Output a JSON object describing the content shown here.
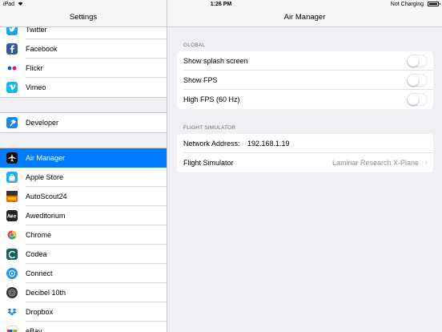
{
  "status": {
    "device": "iPad",
    "time": "1:26 PM",
    "charging": "Not Charging"
  },
  "sidebar": {
    "title": "Settings",
    "group1": [
      {
        "label": "Twitter",
        "icon": "twitter-icon",
        "color": "#1da1f2"
      },
      {
        "label": "Facebook",
        "icon": "facebook-icon",
        "color": "#3b5998"
      },
      {
        "label": "Flickr",
        "icon": "flickr-icon",
        "color": "#ffffff"
      },
      {
        "label": "Vimeo",
        "icon": "vimeo-icon",
        "color": "#1ab7ea"
      }
    ],
    "group2": [
      {
        "label": "Developer",
        "icon": "hammer-icon",
        "color": "#1e88e5"
      }
    ],
    "group3": [
      {
        "label": "Air Manager",
        "icon": "airplane-icon",
        "color": "#111111",
        "selected": true
      },
      {
        "label": "Apple Store",
        "icon": "apple-store-icon",
        "color": "#29a8f2"
      },
      {
        "label": "AutoScout24",
        "icon": "autoscout-icon",
        "color": "#f26522"
      },
      {
        "label": "Aweditorium",
        "icon": "aweditorium-icon",
        "color": "#222222"
      },
      {
        "label": "Chrome",
        "icon": "chrome-icon",
        "color": "#ffffff"
      },
      {
        "label": "Codea",
        "icon": "codea-icon",
        "color": "#1b5e55"
      },
      {
        "label": "Connect",
        "icon": "connect-icon",
        "color": "#2196f3"
      },
      {
        "label": "Decibel 10th",
        "icon": "decibel-icon",
        "color": "#333333"
      },
      {
        "label": "Dropbox",
        "icon": "dropbox-icon",
        "color": "#ffffff"
      },
      {
        "label": "eBay",
        "icon": "ebay-icon",
        "color": "#ffffff"
      }
    ]
  },
  "detail": {
    "title": "Air Manager",
    "global_header": "GLOBAL",
    "toggles": [
      {
        "label": "Show splash screen",
        "on": false
      },
      {
        "label": "Show FPS",
        "on": false
      },
      {
        "label": "High FPS (60 Hz)",
        "on": false
      }
    ],
    "sim_header": "FLIGHT SIMULATOR",
    "network_label": "Network Address:",
    "network_value": "192.168.1.19",
    "sim_label": "Flight Simulator",
    "sim_value": "Laminar Research X-Plane"
  },
  "colors": {
    "accent": "#007aff",
    "background": "#efeff4"
  }
}
